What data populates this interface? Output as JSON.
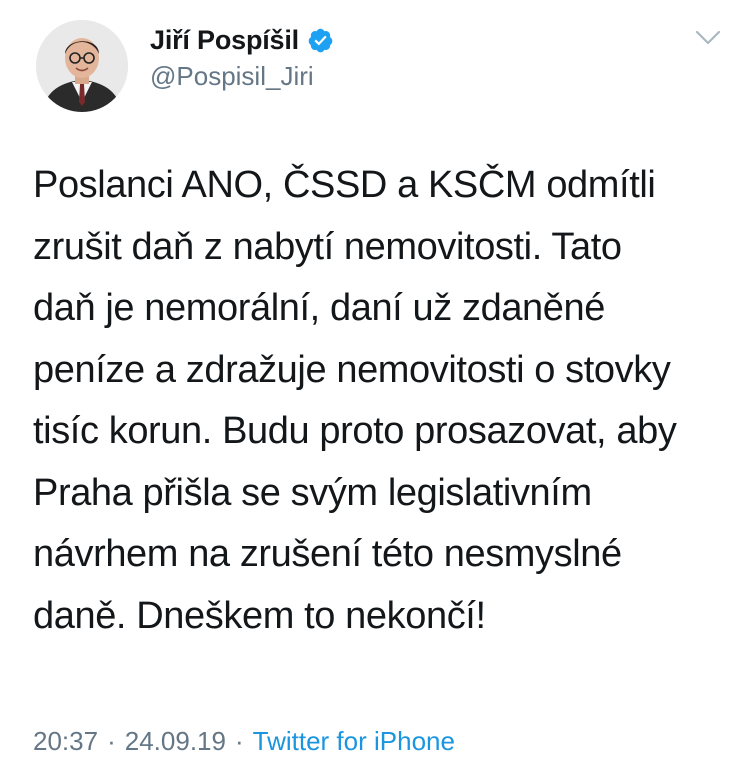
{
  "author": {
    "display_name": "Jiří Pospíšil",
    "handle": "@Pospisil_Jiri",
    "verified": true,
    "avatar_icon": "profile-photo"
  },
  "menu": {
    "icon": "chevron-down-icon"
  },
  "tweet": {
    "text": "Poslanci ANO, ČSSD a KSČM odmítli\nzrušit daň z nabytí nemovitosti. Tato\ndaň je nemorální, daní už zdaněné\npeníze a zdražuje nemovitosti o stovky\ntisíc korun. Budu proto prosazovat, aby\nPraha přišla se svým legislativním\nnávrhem na zrušení této nesmyslné\ndaně. Dneškem to nekončí!"
  },
  "meta": {
    "time": "20:37",
    "separator": "·",
    "date": "24.09.19",
    "source": "Twitter for iPhone"
  },
  "colors": {
    "text": "#14171a",
    "secondary": "#657786",
    "link": "#1b95e0",
    "verified": "#1da1f2"
  }
}
